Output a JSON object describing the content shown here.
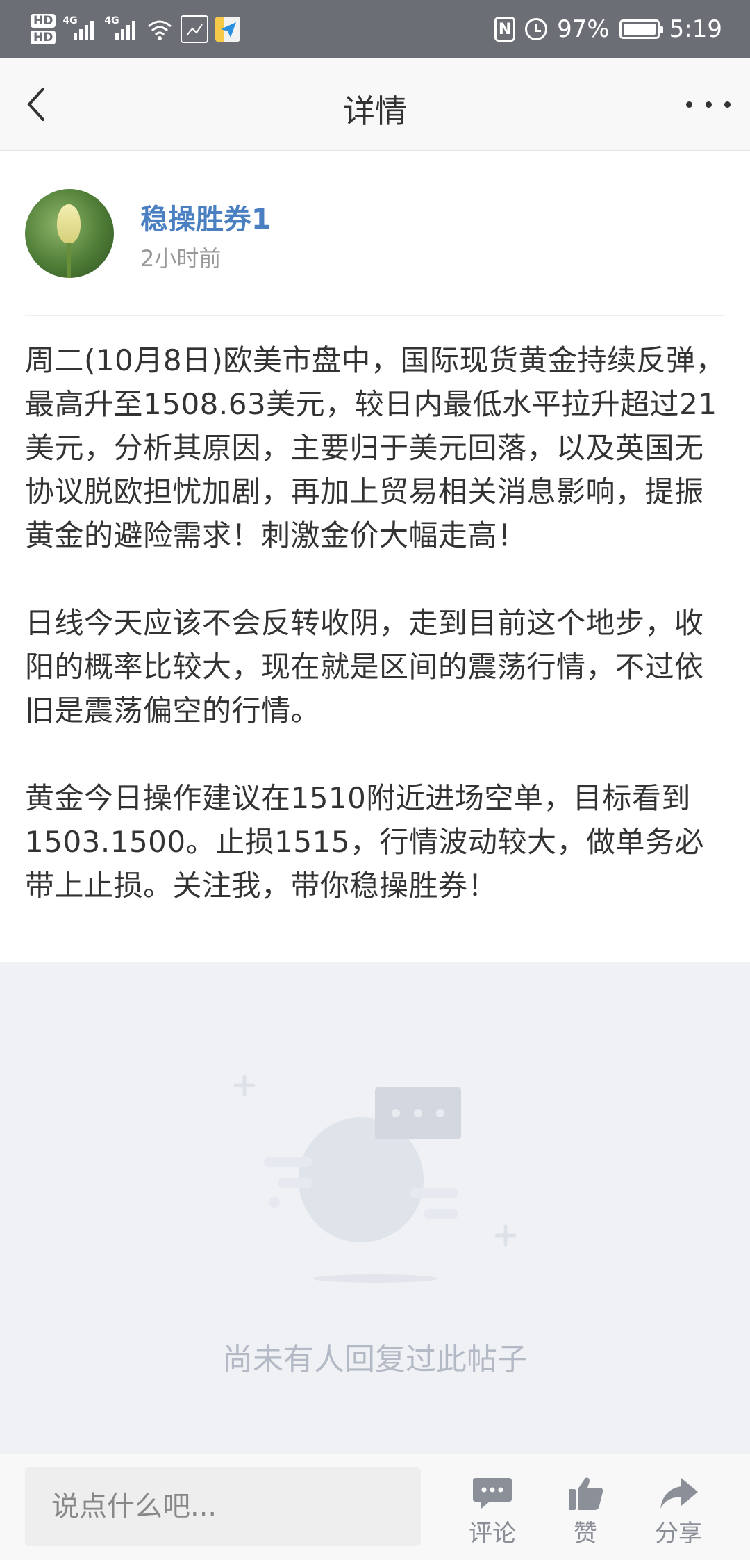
{
  "status_bar": {
    "hd1": "HD",
    "hd2": "HD",
    "net1": "4G",
    "net2": "4G",
    "battery_level": "97%",
    "time": "5:19",
    "color": "#6b6e75"
  },
  "nav": {
    "title": "详情",
    "back_icon": "chevron-left-icon",
    "more_icon": "more-horizontal-icon"
  },
  "post": {
    "author": "稳操胜券1",
    "time": "2小时前",
    "paragraphs": [
      "周二(10月8日)欧美市盘中，国际现货黄金持续反弹，最高升至1508.63美元，较日内最低水平拉升超过21美元，分析其原因，主要归于美元回落，以及英国无协议脱欧担忧加剧，再加上贸易相关消息影响，提振黄金的避险需求！刺激金价大幅走高！",
      "日线今天应该不会反转收阴，走到目前这个地步，收阳的概率比较大，现在就是区间的震荡行情，不过依旧是震荡偏空的行情。",
      "黄金今日操作建议在1510附近进场空单，目标看到1503.1500。止损1515，行情波动较大，做单务必带上止损。关注我，带你稳操胜券！"
    ]
  },
  "empty_state": {
    "text": "尚未有人回复过此帖子"
  },
  "bottom_bar": {
    "input_placeholder": "说点什么吧...",
    "comment_label": "评论",
    "like_label": "赞",
    "share_label": "分享"
  },
  "colors": {
    "author_name": "#4a7fc1",
    "empty_bg": "#eff1f4",
    "icon_gray": "#8a8f98"
  }
}
